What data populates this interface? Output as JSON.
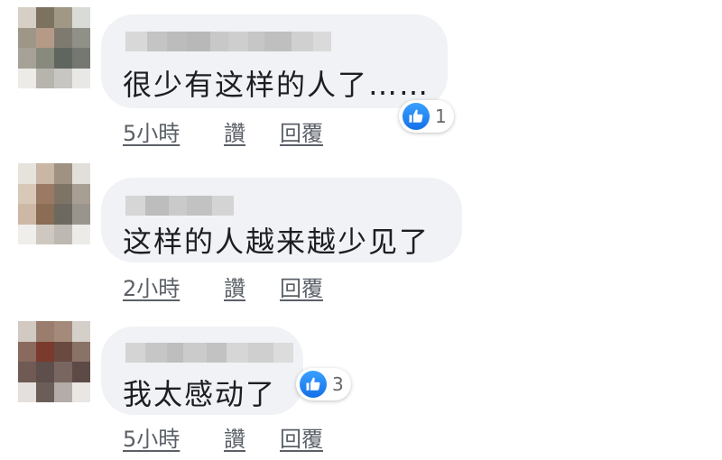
{
  "comments": [
    {
      "text": "很少有这样的人了……",
      "reactions": {
        "icon": "thumbs-up-icon",
        "count": "1"
      },
      "timestamp": "5小時",
      "like_label": "讚",
      "reply_label": "回覆"
    },
    {
      "text": "这样的人越来越少见了",
      "reactions": null,
      "timestamp": "2小時",
      "like_label": "讚",
      "reply_label": "回覆"
    },
    {
      "text": "我太感动了",
      "reactions": {
        "icon": "thumbs-up-icon",
        "count": "3"
      },
      "timestamp": "5小時",
      "like_label": "讚",
      "reply_label": "回覆"
    }
  ],
  "colors": {
    "bubble": "#f0f2f5",
    "text": "#1c1e21",
    "meta": "#5b6068",
    "like_blue": "#1877f2"
  }
}
